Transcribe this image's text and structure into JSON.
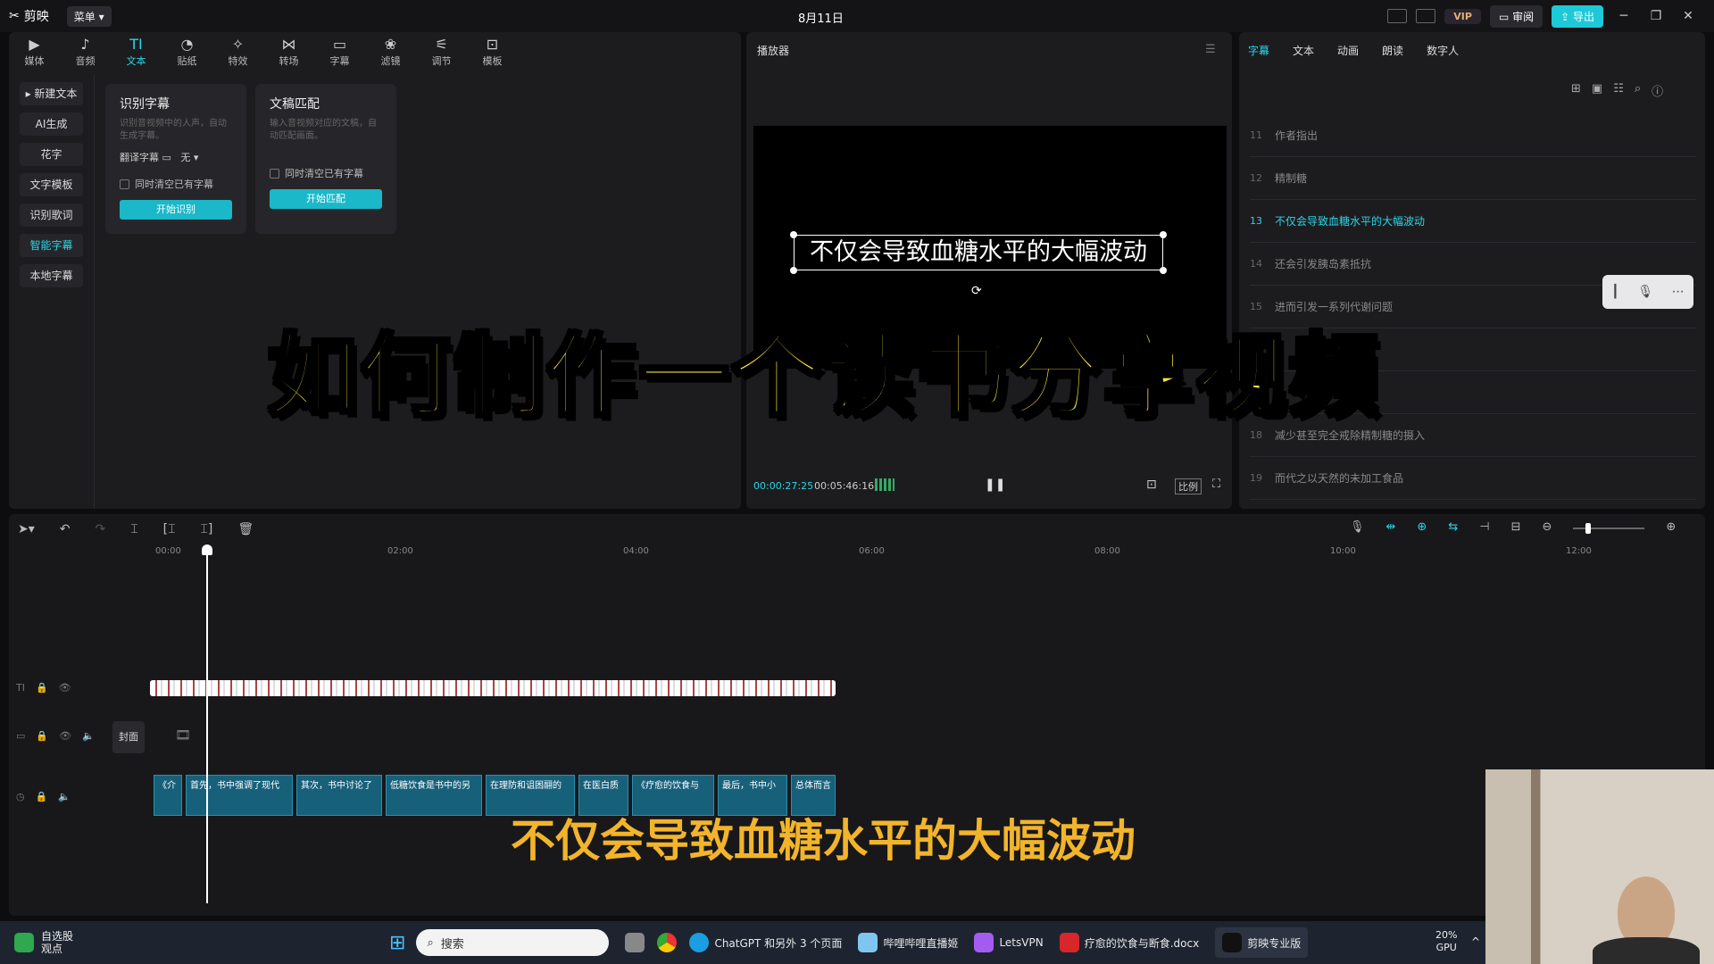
{
  "app": {
    "name": "剪映",
    "menu_label": "菜单",
    "date": "8月11日"
  },
  "titlebar": {
    "vip_label": "VIP",
    "review_label": "审阅",
    "export_label": "导出"
  },
  "tools": [
    {
      "label": "媒体",
      "glyph": "▶"
    },
    {
      "label": "音频",
      "glyph": "♪"
    },
    {
      "label": "文本",
      "glyph": "TI"
    },
    {
      "label": "贴纸",
      "glyph": "◔"
    },
    {
      "label": "特效",
      "glyph": "✧"
    },
    {
      "label": "转场",
      "glyph": "⋈"
    },
    {
      "label": "字幕",
      "glyph": "▭"
    },
    {
      "label": "滤镜",
      "glyph": "❀"
    },
    {
      "label": "调节",
      "glyph": "⚟"
    },
    {
      "label": "模板",
      "glyph": "⊡"
    }
  ],
  "sidebar": [
    "新建文本",
    "AI生成",
    "花字",
    "文字模板",
    "识别歌词",
    "智能字幕",
    "本地字幕"
  ],
  "card1": {
    "title": "识别字幕",
    "desc": "识别音视频中的人声，自动生成字幕。",
    "translate_label": "翻译字幕",
    "translate_value": "无",
    "checkbox": "同时清空已有字幕",
    "button": "开始识别"
  },
  "card2": {
    "title": "文稿匹配",
    "desc": "输入音视频对应的文稿，自动匹配画面。",
    "checkbox": "同时清空已有字幕",
    "button": "开始匹配"
  },
  "player": {
    "title": "播放器",
    "subtitle_text": "不仅会导致血糖水平的大幅波动",
    "time_current": "00:00:27:25",
    "time_total": "00:05:46:16",
    "ratio_label": "比例"
  },
  "right_tabs": [
    "字幕",
    "文本",
    "动画",
    "朗读",
    "数字人"
  ],
  "subtitles": [
    {
      "num": "11",
      "text": "作者指出"
    },
    {
      "num": "12",
      "text": "精制糖"
    },
    {
      "num": "13",
      "text": "不仅会导致血糖水平的大幅波动"
    },
    {
      "num": "14",
      "text": "还会引发胰岛素抵抗"
    },
    {
      "num": "15",
      "text": "进而引发一系列代谢问题"
    },
    {
      "num": "16",
      "text": ""
    },
    {
      "num": "17",
      "text": ""
    },
    {
      "num": "18",
      "text": "减少甚至完全戒除精制糖的摄入"
    },
    {
      "num": "19",
      "text": "而代之以天然的未加工食品"
    }
  ],
  "overlay": {
    "title": "如何制作一个读书分享视频",
    "caption": "不仅会导致血糖水平的大幅波动"
  },
  "timeline": {
    "ruler": [
      "00:00",
      "02:00",
      "04:00",
      "06:00",
      "08:00",
      "10:00",
      "12:00"
    ],
    "cover_label": "封面",
    "audio_clips": [
      "《介",
      "首先，书中强调了现代",
      "其次，书中讨论了",
      "低糖饮食是书中的另",
      "在理防和诅困翮的",
      "在医白质",
      "《疗愈的饮食与",
      "最后，书中小",
      "总体而言"
    ]
  },
  "taskbar": {
    "stock_label": "自选股",
    "stock_sub": "观点",
    "search_placeholder": "搜索",
    "apps": [
      "ChatGPT 和另外 3 个页面",
      "哔哩哔哩直播姬",
      "LetsVPN",
      "疗愈的饮食与断食.docx",
      "剪映专业版"
    ],
    "gpu_pct": "20%",
    "gpu_label": "GPU"
  },
  "colors": {
    "accent": "#2dd4e6",
    "title_yellow": "#f6e23a",
    "caption_orange": "#f2b42a"
  }
}
